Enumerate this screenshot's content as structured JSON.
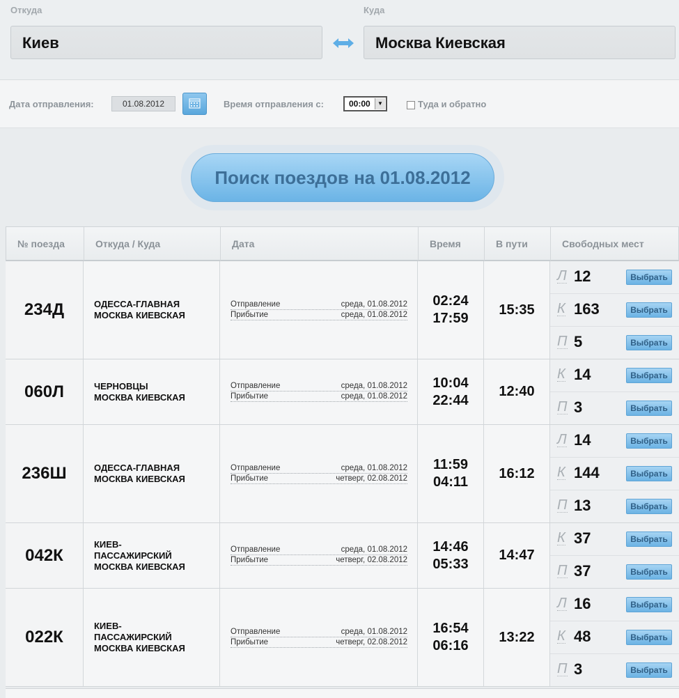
{
  "route": {
    "from_label": "Откуда",
    "to_label": "Куда",
    "from_value": "Киев",
    "to_value": "Москва Киевская"
  },
  "options": {
    "date_label": "Дата отправления:",
    "date_value": "01.08.2012",
    "time_label": "Время отправления с:",
    "time_value": "00:00",
    "roundtrip_label": "Туда и обратно",
    "roundtrip_checked": false
  },
  "search_button": "Поиск поездов на 01.08.2012",
  "table": {
    "headers": {
      "number": "№ поезда",
      "route": "Откуда / Куда",
      "date": "Дата",
      "time": "Время",
      "duration": "В пути",
      "seats": "Свободных мест"
    },
    "depart_label": "Отправление",
    "arrive_label": "Прибытие",
    "select_label": "Выбрать",
    "rows": [
      {
        "number": "234Д",
        "from": "ОДЕССА-ГЛАВНАЯ",
        "to": "МОСКВА КИЕВСКАЯ",
        "depart_date": "среда, 01.08.2012",
        "arrive_date": "среда, 01.08.2012",
        "depart_time": "02:24",
        "arrive_time": "17:59",
        "duration": "15:35",
        "seats": [
          {
            "type": "Л",
            "count": "12"
          },
          {
            "type": "К",
            "count": "163"
          },
          {
            "type": "П",
            "count": "5"
          }
        ]
      },
      {
        "number": "060Л",
        "from": "ЧЕРНОВЦЫ",
        "to": "МОСКВА КИЕВСКАЯ",
        "depart_date": "среда, 01.08.2012",
        "arrive_date": "среда, 01.08.2012",
        "depart_time": "10:04",
        "arrive_time": "22:44",
        "duration": "12:40",
        "seats": [
          {
            "type": "К",
            "count": "14"
          },
          {
            "type": "П",
            "count": "3"
          }
        ]
      },
      {
        "number": "236Ш",
        "from": "ОДЕССА-ГЛАВНАЯ",
        "to": "МОСКВА КИЕВСКАЯ",
        "depart_date": "среда, 01.08.2012",
        "arrive_date": "четверг, 02.08.2012",
        "depart_time": "11:59",
        "arrive_time": "04:11",
        "duration": "16:12",
        "seats": [
          {
            "type": "Л",
            "count": "14"
          },
          {
            "type": "К",
            "count": "144"
          },
          {
            "type": "П",
            "count": "13"
          }
        ]
      },
      {
        "number": "042К",
        "from": "КИЕВ-ПАССАЖИРСКИЙ",
        "to": "МОСКВА КИЕВСКАЯ",
        "depart_date": "среда, 01.08.2012",
        "arrive_date": "четверг, 02.08.2012",
        "depart_time": "14:46",
        "arrive_time": "05:33",
        "duration": "14:47",
        "seats": [
          {
            "type": "К",
            "count": "37"
          },
          {
            "type": "П",
            "count": "37"
          }
        ]
      },
      {
        "number": "022К",
        "from": "КИЕВ-ПАССАЖИРСКИЙ",
        "to": "МОСКВА КИЕВСКАЯ",
        "depart_date": "среда, 01.08.2012",
        "arrive_date": "четверг, 02.08.2012",
        "depart_time": "16:54",
        "arrive_time": "06:16",
        "duration": "13:22",
        "seats": [
          {
            "type": "Л",
            "count": "16"
          },
          {
            "type": "К",
            "count": "48"
          },
          {
            "type": "П",
            "count": "3"
          }
        ]
      }
    ]
  }
}
